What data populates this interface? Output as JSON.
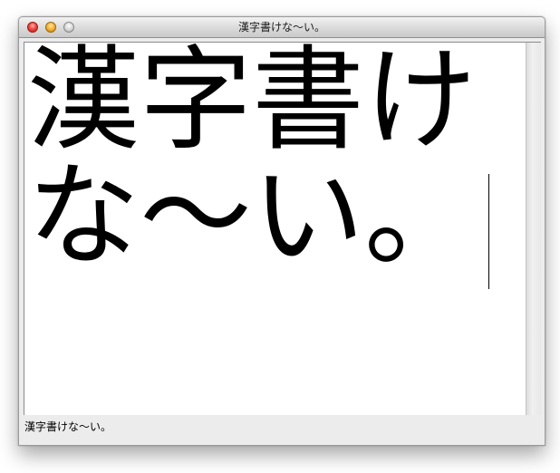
{
  "window": {
    "title": "漢字書けな〜い。"
  },
  "editor": {
    "text": "漢字書けな〜い。"
  },
  "status": {
    "text": "漢字書けな〜い。"
  },
  "colors": {
    "close_button": "#f0483e",
    "minimize_button": "#f7b83a",
    "zoom_button": "#d0d0d0"
  }
}
